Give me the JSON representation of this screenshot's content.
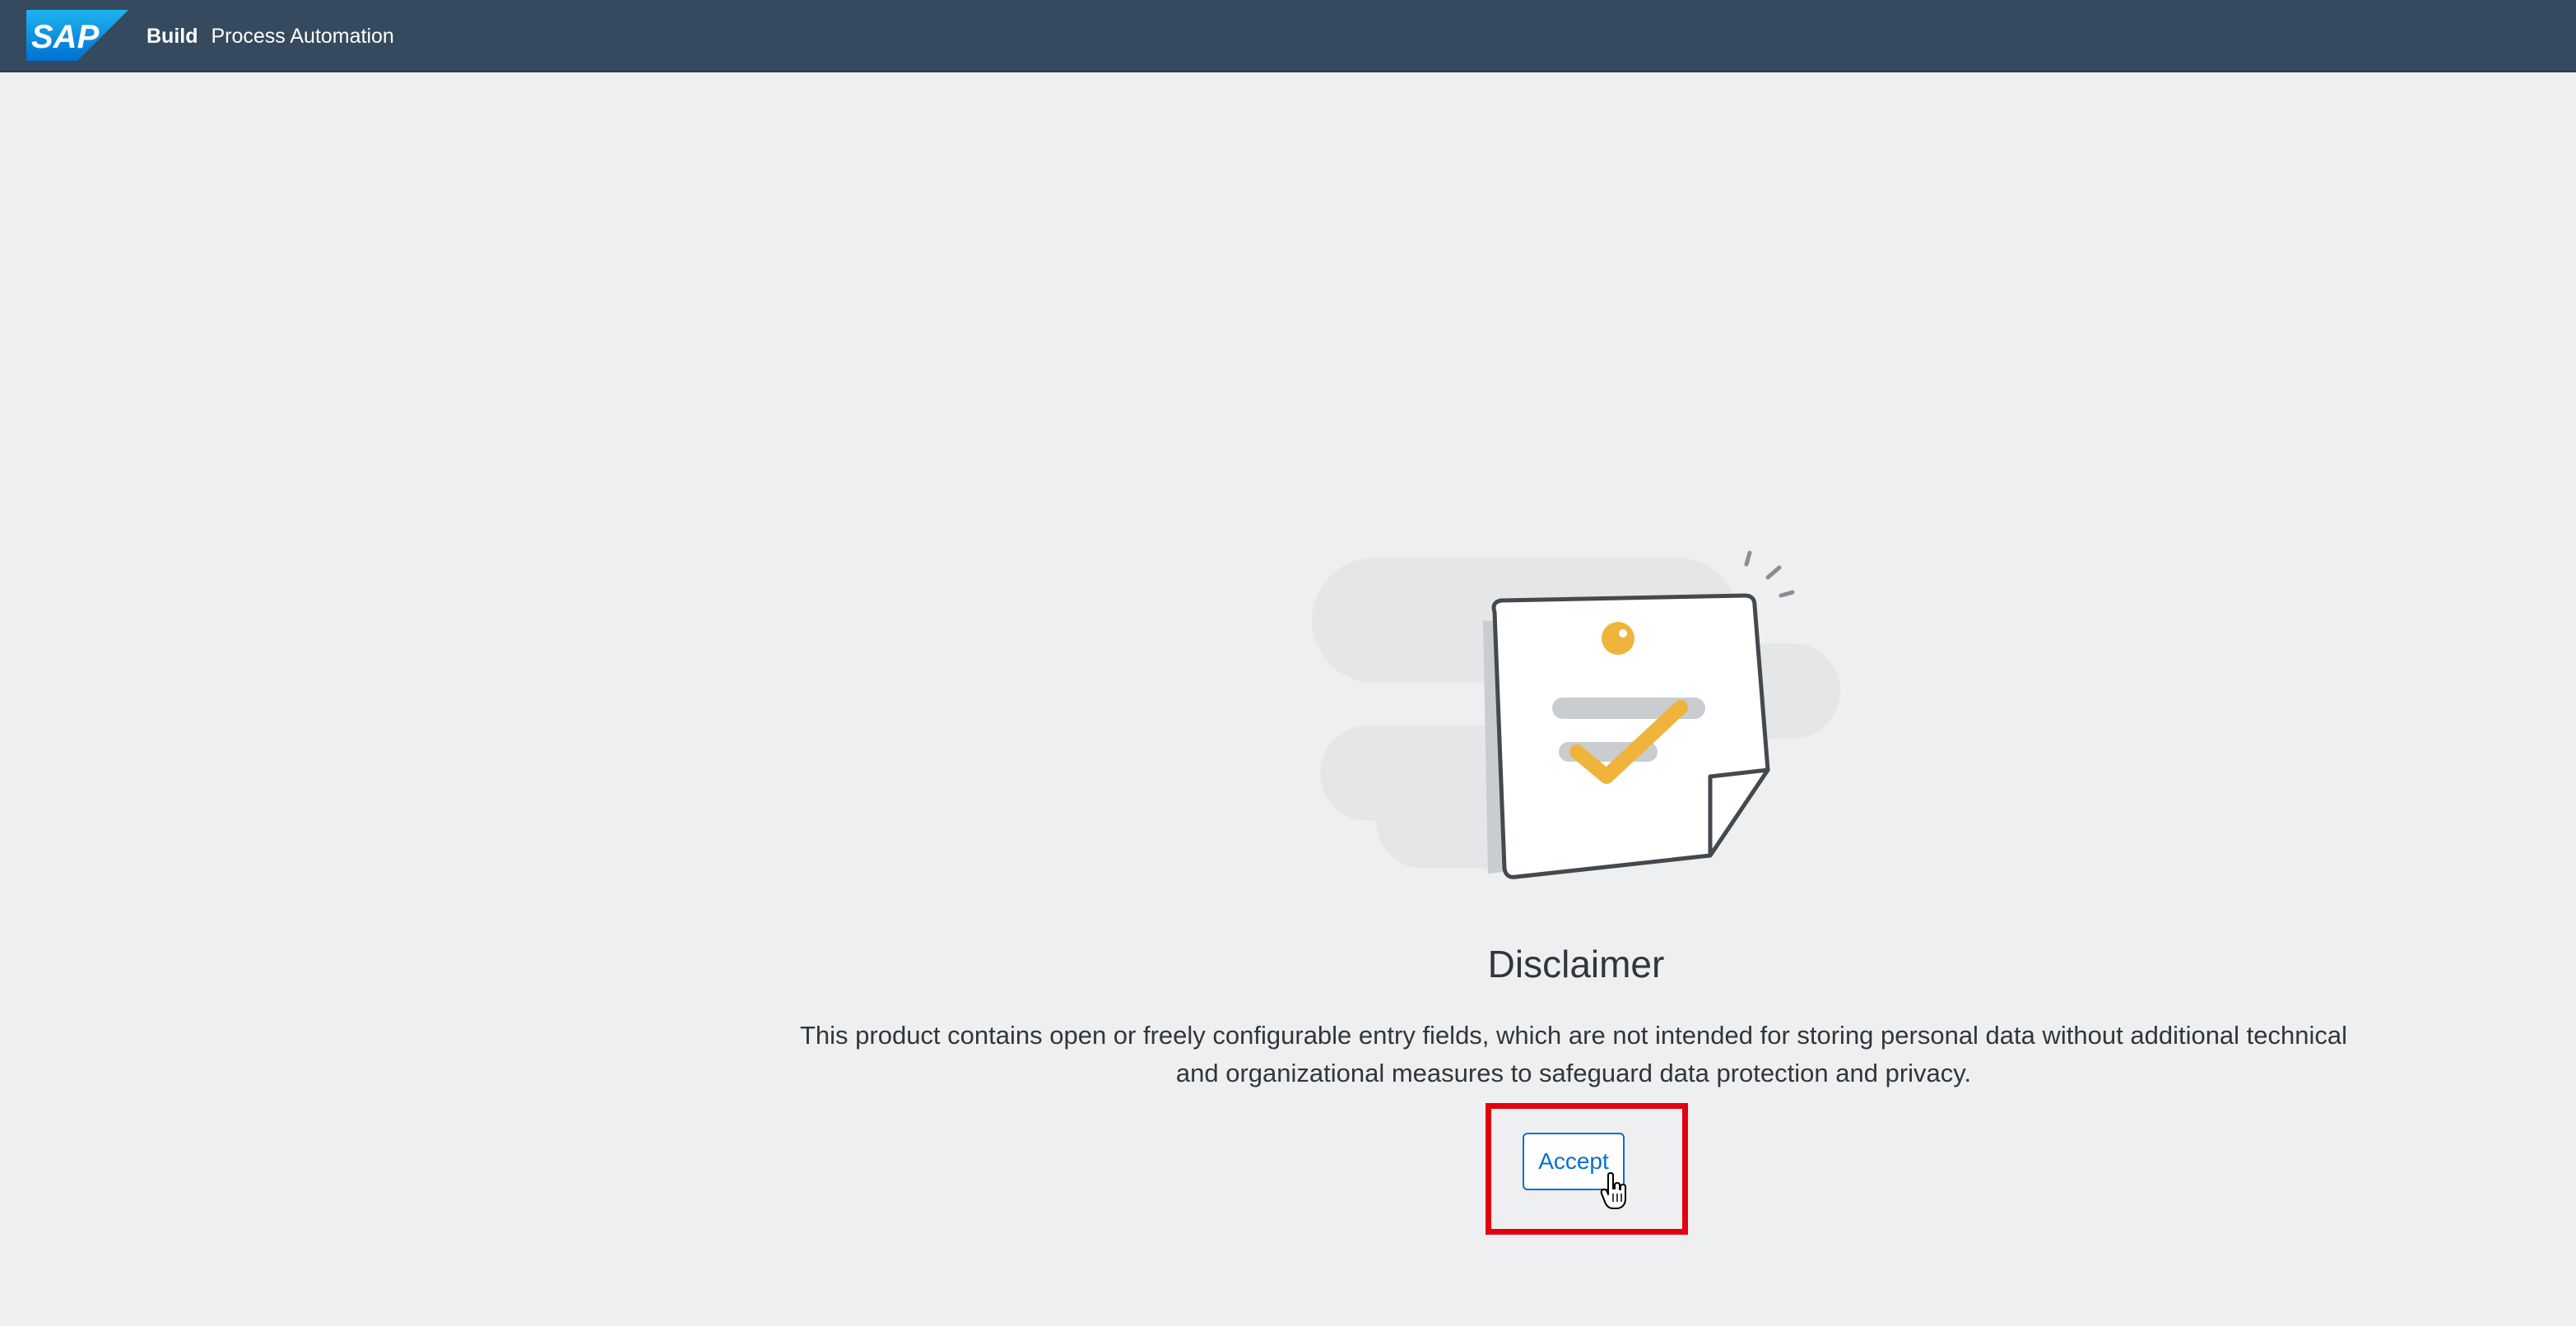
{
  "shell": {
    "logo_text": "SAP",
    "product_name": "Build",
    "app_name": "Process Automation"
  },
  "illustration": {
    "icon": "sticky-note-checkmark-illustration"
  },
  "disclaimer": {
    "title": "Disclaimer",
    "description_line1": "This product contains open or freely configurable entry fields, which are not intended for storing personal data without additional technical",
    "description_line2": "and organizational measures to safeguard data protection and privacy.",
    "accept_label": "Accept"
  },
  "colors": {
    "shell_background": "#354a5f",
    "page_background": "#edeff0",
    "accent": "#0a6ed1",
    "highlight": "#e3000f",
    "check_yellow": "#f0b43c"
  }
}
